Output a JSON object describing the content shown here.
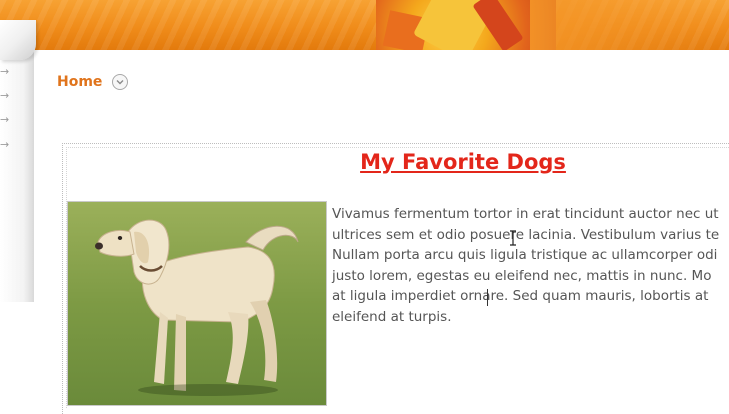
{
  "breadcrumb": {
    "home_label": "Home"
  },
  "article": {
    "title": "My Favorite Dogs",
    "image_subject": "yellow labrador retriever dog",
    "lines": [
      "Vivamus fermentum tortor in erat tincidunt auctor nec ut",
      "ultrices sem et odio posuere lacinia. Vestibulum varius te",
      "Nullam porta arcu quis ligula tristique ac ullamcorper odi",
      "justo lorem, egestas eu eleifend nec, mattis in nunc. Mo",
      "at ligula imperdiet ornare. Sed quam mauris, lobortis at",
      "eleifend at turpis."
    ]
  },
  "colors": {
    "banner": "#f08c1a",
    "breadcrumb_link": "#e0741c",
    "title": "#e3261a",
    "body_text": "#555555"
  },
  "icons": {
    "breadcrumb_toggle": "chevron-down-circle-icon",
    "sidebar_arrows": "arrow-right-icon",
    "cursor": "text-cursor-icon"
  }
}
